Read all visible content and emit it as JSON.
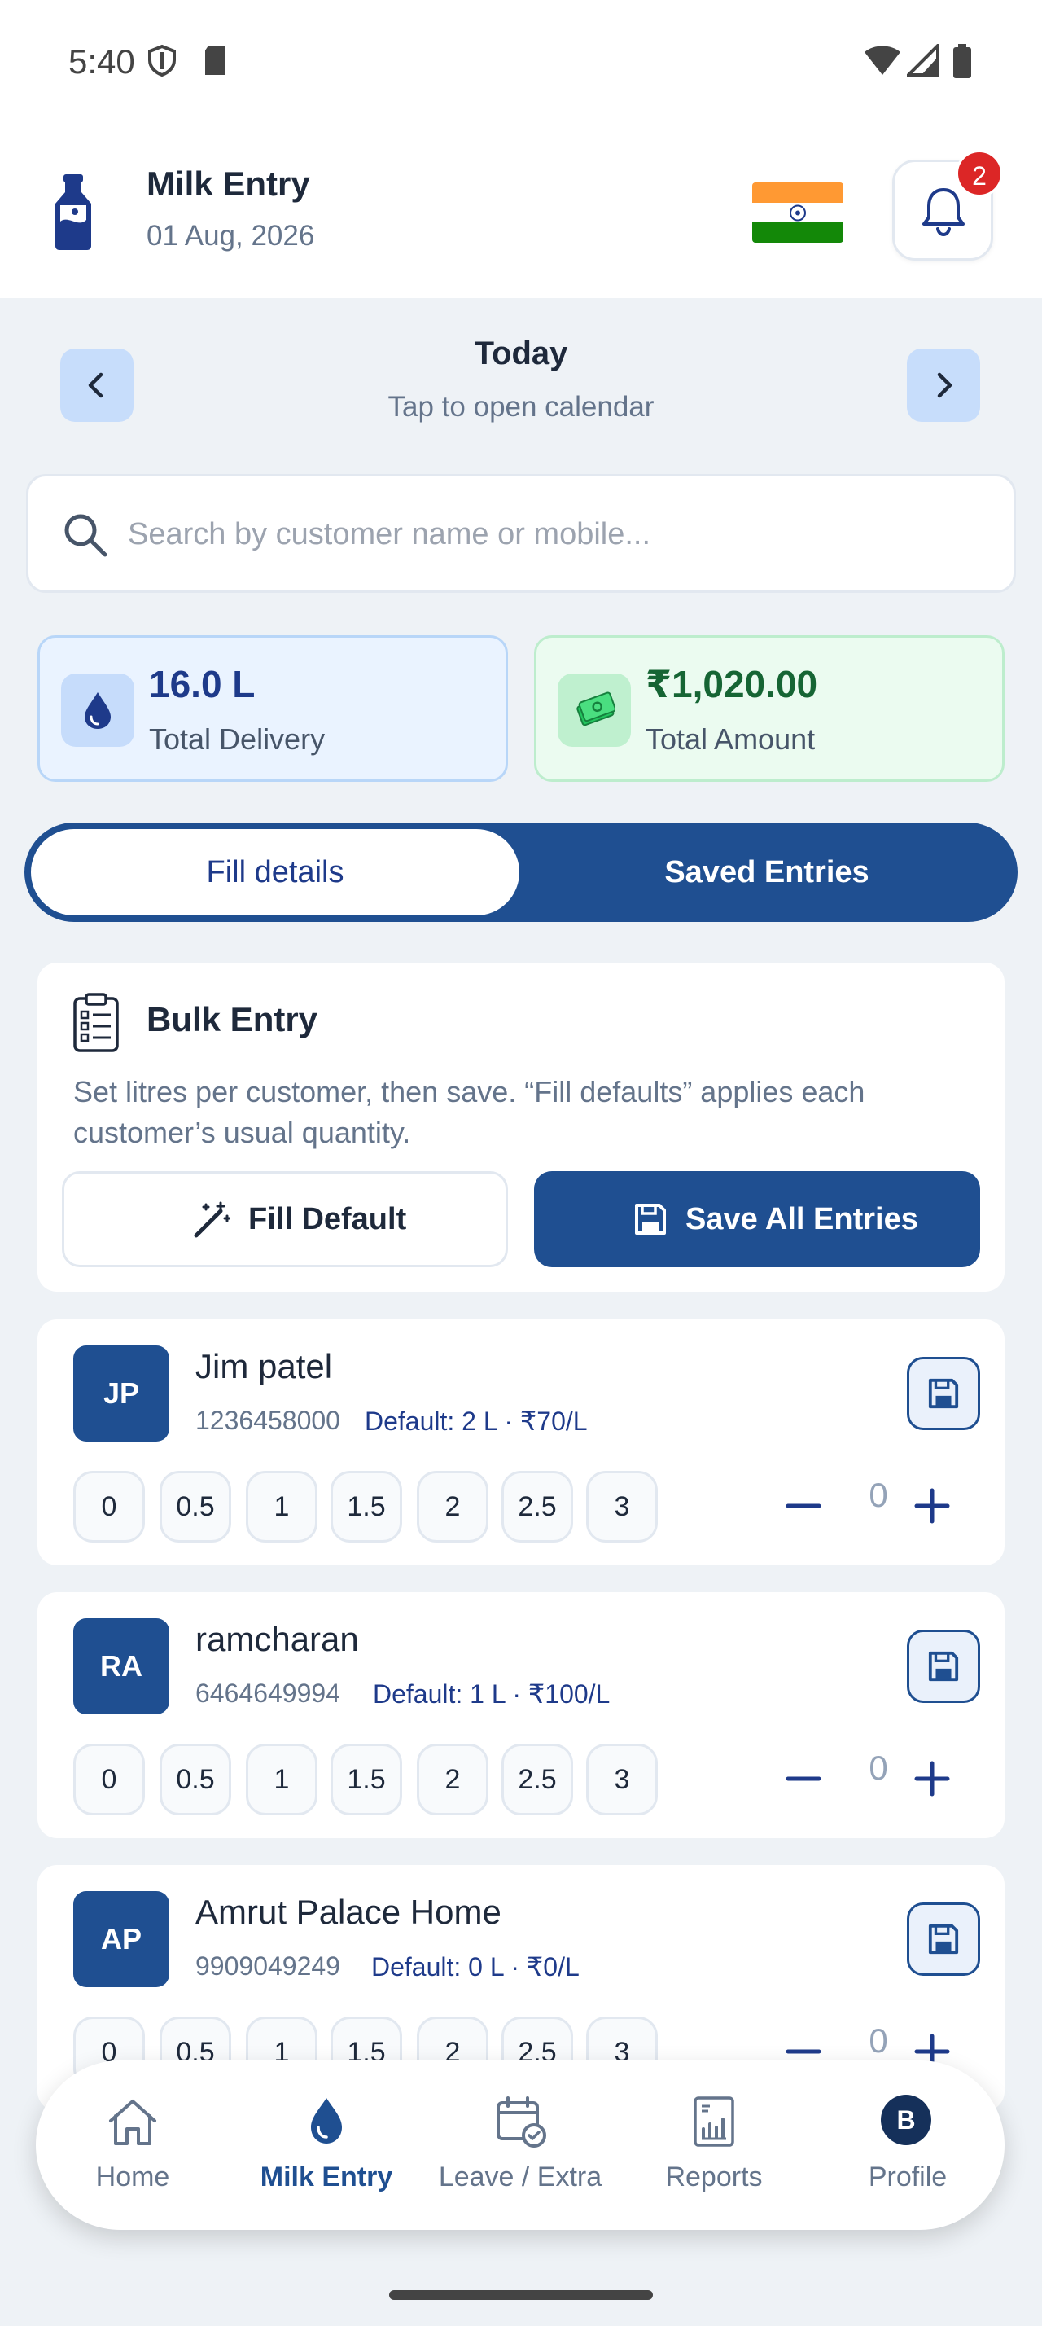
{
  "status_bar": {
    "time": "5:40"
  },
  "header": {
    "title": "Milk Entry",
    "date": "01 Aug, 2026",
    "notification_count": "2"
  },
  "date_nav": {
    "label": "Today",
    "hint": "Tap to open calendar"
  },
  "search": {
    "placeholder": "Search by customer name or mobile..."
  },
  "stats": {
    "delivery": {
      "value": "16.0 L",
      "label": "Total Delivery"
    },
    "amount": {
      "value": "₹1,020.00",
      "label": "Total Amount"
    }
  },
  "tabs": {
    "active": "Fill details",
    "inactive": "Saved Entries"
  },
  "bulk": {
    "title": "Bulk Entry",
    "description": "Set litres per customer, then save. “Fill defaults” applies each customer’s usual quantity.",
    "fill_default": "Fill Default",
    "save_all": "Save All Entries"
  },
  "quantity_options": [
    "0",
    "0.5",
    "1",
    "1.5",
    "2",
    "2.5",
    "3"
  ],
  "customers": [
    {
      "initials": "JP",
      "name": "Jim patel",
      "phone": "1236458000",
      "default": "Default: 2 L · ₹70/L",
      "qty": "0"
    },
    {
      "initials": "RA",
      "name": "ramcharan",
      "phone": "6464649994",
      "default": "Default: 1 L · ₹100/L",
      "qty": "0"
    },
    {
      "initials": "AP",
      "name": "Amrut Palace Home",
      "phone": "9909049249",
      "default": "Default: 0 L · ₹0/L",
      "qty": "0"
    }
  ],
  "bottom_nav": {
    "home": "Home",
    "milk_entry": "Milk Entry",
    "leave_extra": "Leave / Extra",
    "reports": "Reports",
    "profile": "Profile",
    "profile_initial": "B"
  },
  "colors": {
    "primary": "#1f4f91",
    "badge": "#dc2626",
    "blue_card": "#eaf3ff",
    "green_card": "#ebfbf0"
  }
}
